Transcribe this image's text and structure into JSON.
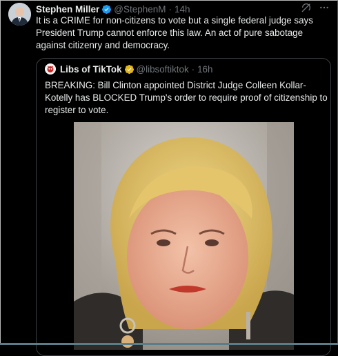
{
  "tweet": {
    "author_name": "Stephen Miller",
    "handle": "@StephenM",
    "separator": "·",
    "time": "14h",
    "text": "It is a CRIME for non-citizens to vote but a single federal judge says President Trump cannot enforce this law. An act of pure sabotage against citizenry and democracy."
  },
  "quote": {
    "author_name": "Libs of TikTok",
    "handle": "@libsoftiktok",
    "separator": "·",
    "time": "16h",
    "text": "BREAKING: Bill Clinton appointed District Judge Colleen Kollar-Kotelly has BLOCKED Trump's order to require proof of citizenship to register to vote."
  },
  "icons": {
    "verified_blue": "verified-icon",
    "verified_gold": "verified-gold-icon",
    "grok": "grok-icon",
    "more": "more-icon"
  },
  "colors": {
    "background": "#000000",
    "text": "#e7e9ea",
    "muted": "#71767b",
    "verified_blue": "#1d9bf0",
    "verified_gold": "#e2b719",
    "border": "#3a3f44"
  }
}
